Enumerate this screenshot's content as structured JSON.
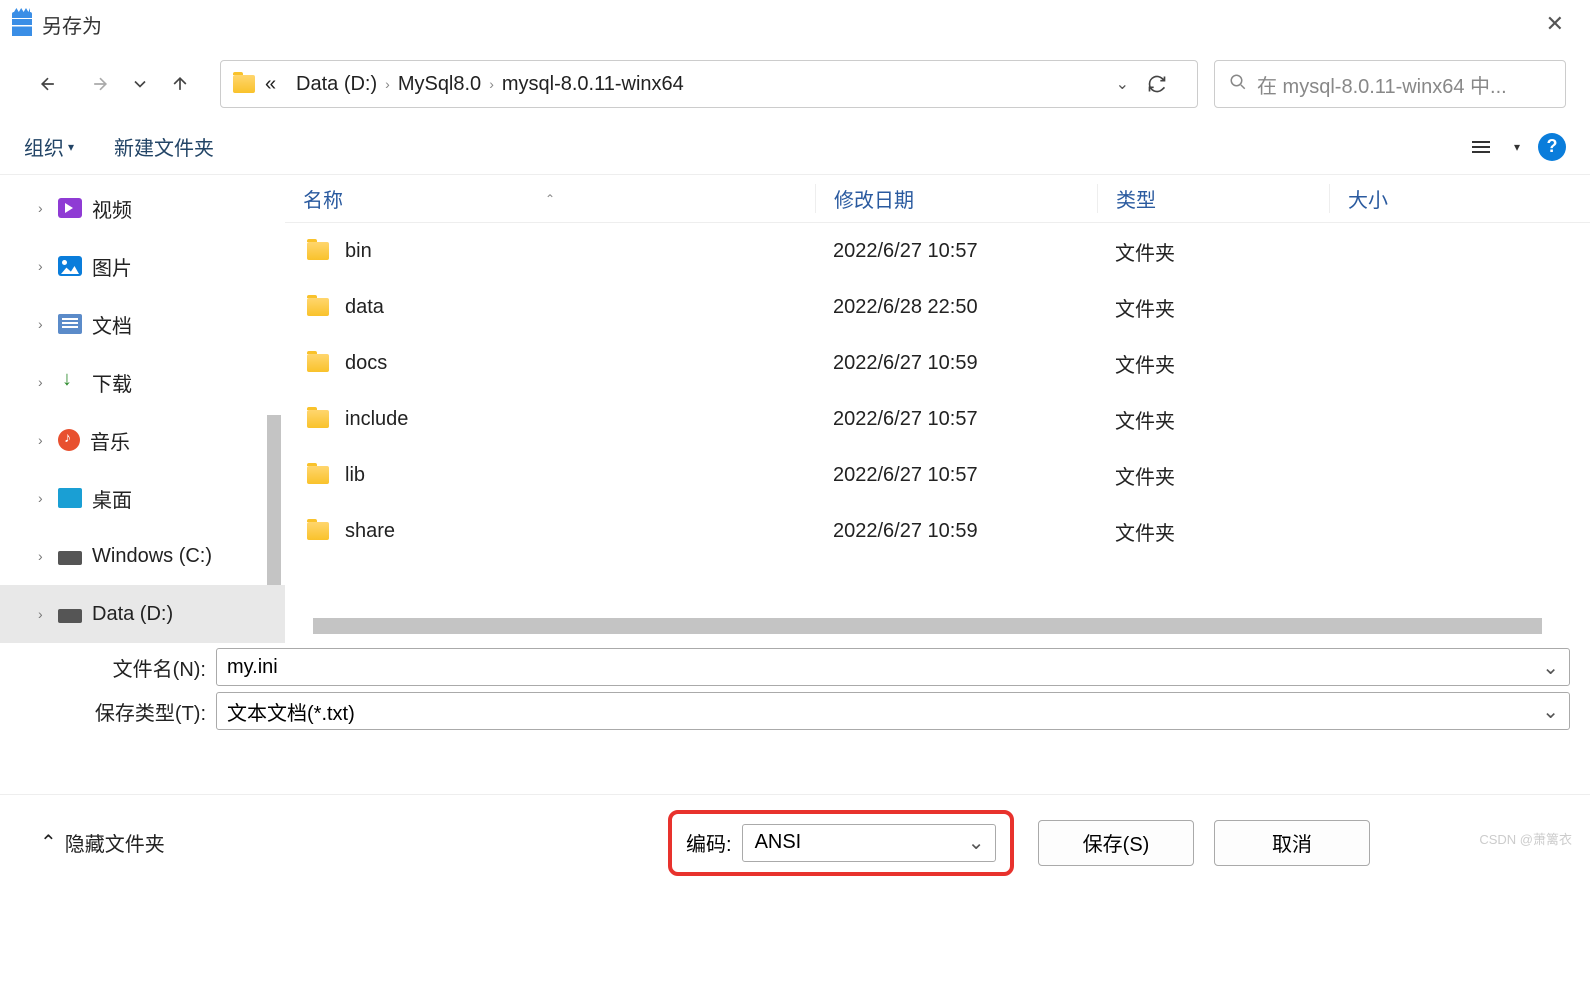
{
  "title": "另存为",
  "breadcrumb": {
    "prefix": "«",
    "parts": [
      "Data (D:)",
      "MySql8.0",
      "mysql-8.0.11-winx64"
    ]
  },
  "search": {
    "placeholder": "在 mysql-8.0.11-winx64 中..."
  },
  "toolbar": {
    "organize": "组织",
    "new_folder": "新建文件夹"
  },
  "sidebar": {
    "items": [
      {
        "label": "视频",
        "icon": "video"
      },
      {
        "label": "图片",
        "icon": "pic"
      },
      {
        "label": "文档",
        "icon": "doc"
      },
      {
        "label": "下载",
        "icon": "down"
      },
      {
        "label": "音乐",
        "icon": "music"
      },
      {
        "label": "桌面",
        "icon": "desk"
      },
      {
        "label": "Windows (C:)",
        "icon": "drive"
      },
      {
        "label": "Data (D:)",
        "icon": "drive",
        "selected": true
      }
    ]
  },
  "columns": {
    "name": "名称",
    "date": "修改日期",
    "type": "类型",
    "size": "大小"
  },
  "files": [
    {
      "name": "bin",
      "date": "2022/6/27 10:57",
      "type": "文件夹"
    },
    {
      "name": "data",
      "date": "2022/6/28 22:50",
      "type": "文件夹"
    },
    {
      "name": "docs",
      "date": "2022/6/27 10:59",
      "type": "文件夹"
    },
    {
      "name": "include",
      "date": "2022/6/27 10:57",
      "type": "文件夹"
    },
    {
      "name": "lib",
      "date": "2022/6/27 10:57",
      "type": "文件夹"
    },
    {
      "name": "share",
      "date": "2022/6/27 10:59",
      "type": "文件夹"
    }
  ],
  "filename": {
    "label": "文件名(N):",
    "value": "my.ini"
  },
  "filetype": {
    "label": "保存类型(T):",
    "value": "文本文档(*.txt)"
  },
  "hide_folders": "隐藏文件夹",
  "encoding": {
    "label": "编码:",
    "value": "ANSI"
  },
  "buttons": {
    "save": "保存(S)",
    "cancel": "取消"
  },
  "watermark": "CSDN @萧篱衣"
}
